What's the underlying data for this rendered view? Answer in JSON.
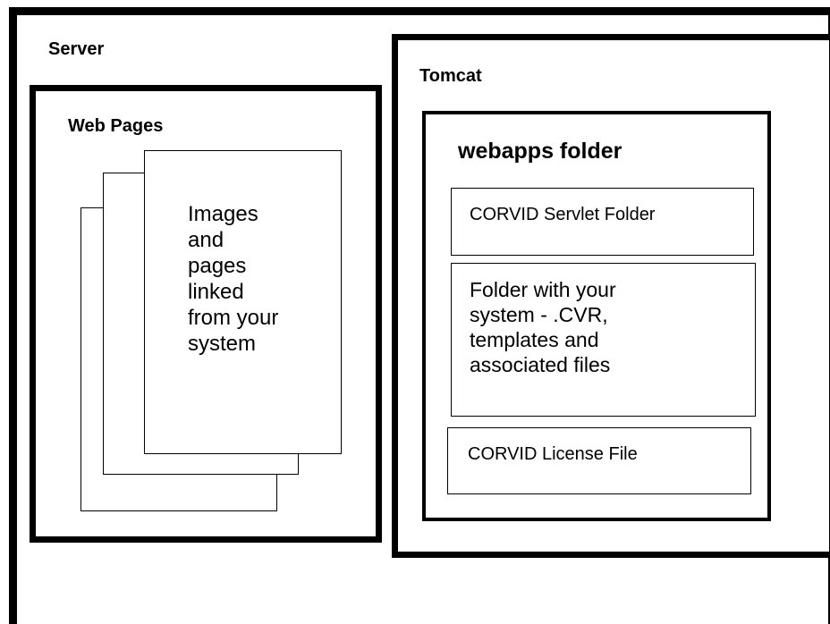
{
  "server": {
    "title": "Server"
  },
  "web_pages": {
    "title": "Web Pages",
    "page_text": "Images\nand\npages\nlinked\nfrom your\nsystem"
  },
  "tomcat": {
    "title": "Tomcat",
    "webapps": {
      "title": "webapps folder",
      "servlet_folder": "CORVID Servlet Folder",
      "system_folder": "Folder with your\nsystem - .CVR,\ntemplates and\nassociated files",
      "license_file": "CORVID License File"
    }
  }
}
